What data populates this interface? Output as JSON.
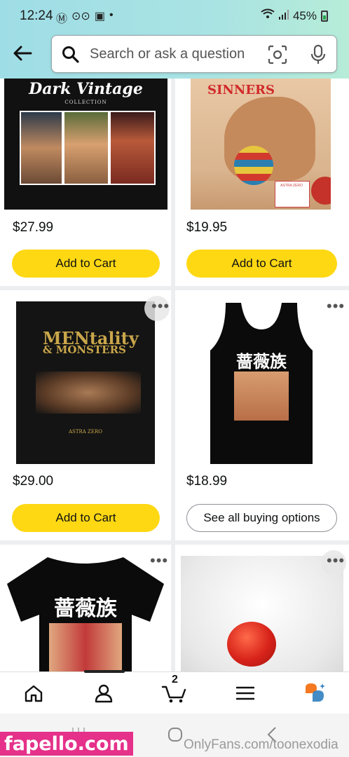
{
  "status_bar": {
    "time": "12:24",
    "battery": "45%"
  },
  "search": {
    "placeholder": "Search or ask a question"
  },
  "products": [
    {
      "price": "$27.99",
      "action": "Add to Cart",
      "cover_title": "Dark Vintage",
      "cover_subtitle": "COLLECTION"
    },
    {
      "price": "$19.95",
      "action": "Add to Cart",
      "cover_title": "SINNERS",
      "cover_sign": "ASTRA ZERO"
    },
    {
      "price": "$29.00",
      "action": "Add to Cart",
      "cover_title": "MENtality",
      "cover_title2": "& MONSTERS",
      "cover_author": "ASTRA ZERO"
    },
    {
      "price": "$18.99",
      "action": "See all buying options",
      "print_text": "蔷薇族"
    },
    {
      "print_text": "蔷薇族"
    },
    {}
  ],
  "more_glyph": "•••",
  "bottom_nav": {
    "cart_count": "2"
  },
  "watermark": {
    "site": "fapello.com",
    "text": "OnlyFans.com/toonexodia"
  },
  "colors": {
    "accent_button": "#ffd814",
    "header_gradient_start": "#9fdde6",
    "header_gradient_end": "#b6ecd8",
    "watermark_bg": "#e5318a"
  }
}
